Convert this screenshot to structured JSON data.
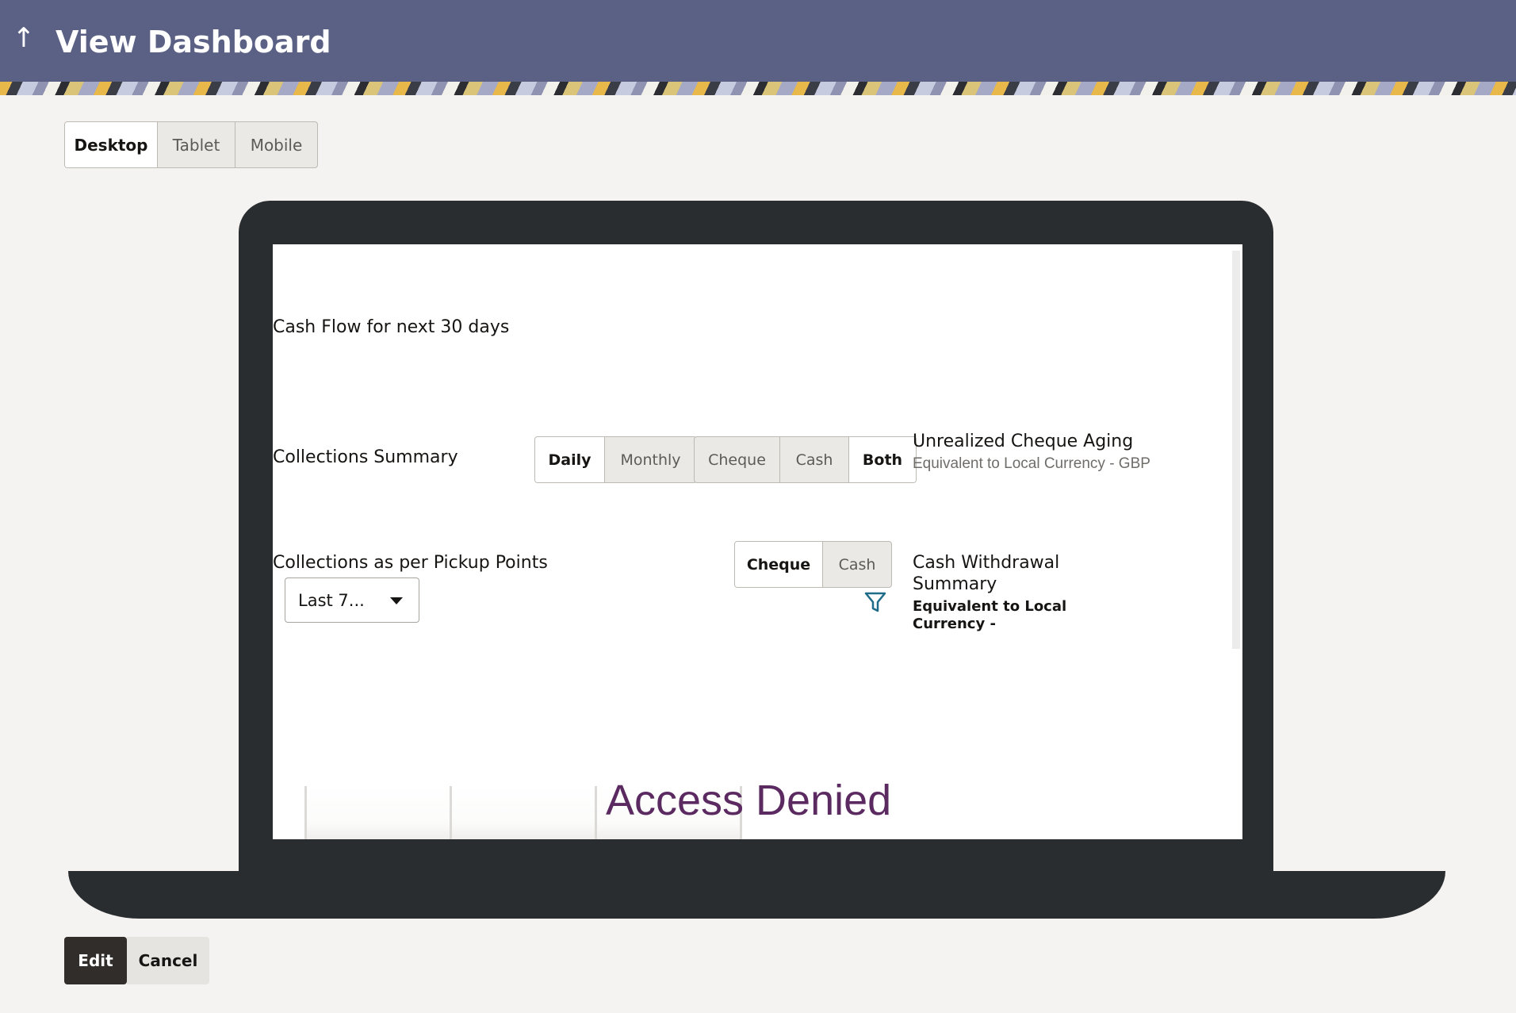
{
  "header": {
    "back_icon": "arrow-up-icon",
    "title": "View Dashboard"
  },
  "device_switcher": {
    "options": [
      "Desktop",
      "Tablet",
      "Mobile"
    ],
    "selected": "Desktop"
  },
  "widgets": {
    "cash_flow": {
      "title": "Cash Flow for next 30 days"
    },
    "collections_summary": {
      "title": "Collections Summary",
      "period_toggle": [
        "Daily",
        "Monthly"
      ],
      "period_selected": "Daily",
      "type_toggle": [
        "Cheque",
        "Cash",
        "Both"
      ],
      "type_selected": "Both"
    },
    "unrealized_cheque": {
      "title": "Unrealized Cheque Aging",
      "subtitle": "Equivalent to Local Currency - GBP"
    },
    "pickup_points": {
      "title": "Collections as per Pickup Points",
      "dropdown_value": "Last 7..."
    },
    "pickup_toggle": {
      "options": [
        "Cheque",
        "Cash"
      ],
      "selected": "Cheque",
      "filter_icon": "filter-icon"
    },
    "cash_withdrawal": {
      "title_line1": "Cash Withdrawal",
      "title_line2": "Summary",
      "currency_line1": "Equivalent to Local",
      "currency_line2": "Currency -"
    },
    "access_denied": {
      "text": "Access Denied"
    }
  },
  "actions": {
    "edit_label": "Edit",
    "cancel_label": "Cancel"
  },
  "colors": {
    "header_bg": "#5b6185",
    "access_denied": "#5b2a61",
    "edit_button": "#312d2a",
    "filter_icon": "#1f6b8a"
  }
}
